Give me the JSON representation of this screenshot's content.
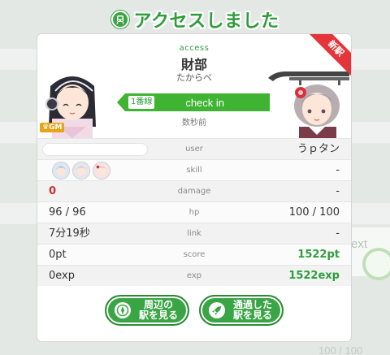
{
  "header": {
    "title": "アクセスしました",
    "icon": "train-icon"
  },
  "station": {
    "access_label": "access",
    "name": "財部",
    "kana": "たからべ",
    "line_badge": "1番線",
    "checkin_label": "check in",
    "time_ago": "数秒前",
    "corner_label": "新駅"
  },
  "characters": {
    "left_badge": "GM"
  },
  "stats": {
    "user": {
      "label": "user",
      "right": "うｐタン"
    },
    "skill": {
      "label": "skill",
      "right": "-"
    },
    "damage": {
      "label": "damage",
      "left": "0",
      "right": "-"
    },
    "hp": {
      "label": "hp",
      "left": "96 / 96",
      "right": "100 / 100"
    },
    "link": {
      "label": "link",
      "left": "7分19秒",
      "right": "-"
    },
    "score": {
      "label": "score",
      "left": "0pt",
      "right": "1522pt"
    },
    "exp": {
      "label": "exp",
      "left": "0exp",
      "right": "1522exp"
    }
  },
  "buttons": {
    "nearby": {
      "line1": "周辺の",
      "line2": "駅を見る",
      "icon": "compass-icon"
    },
    "passed": {
      "line1": "通過した",
      "line2": "駅を見る",
      "icon": "rocket-icon"
    }
  },
  "background": {
    "text": "ext",
    "bottom_text": "100 / 100"
  },
  "colors": {
    "accent": "#3aa544",
    "damage": "#d32f2f",
    "ribbon": "#e5343a",
    "gm_badge": "#e8a317"
  }
}
